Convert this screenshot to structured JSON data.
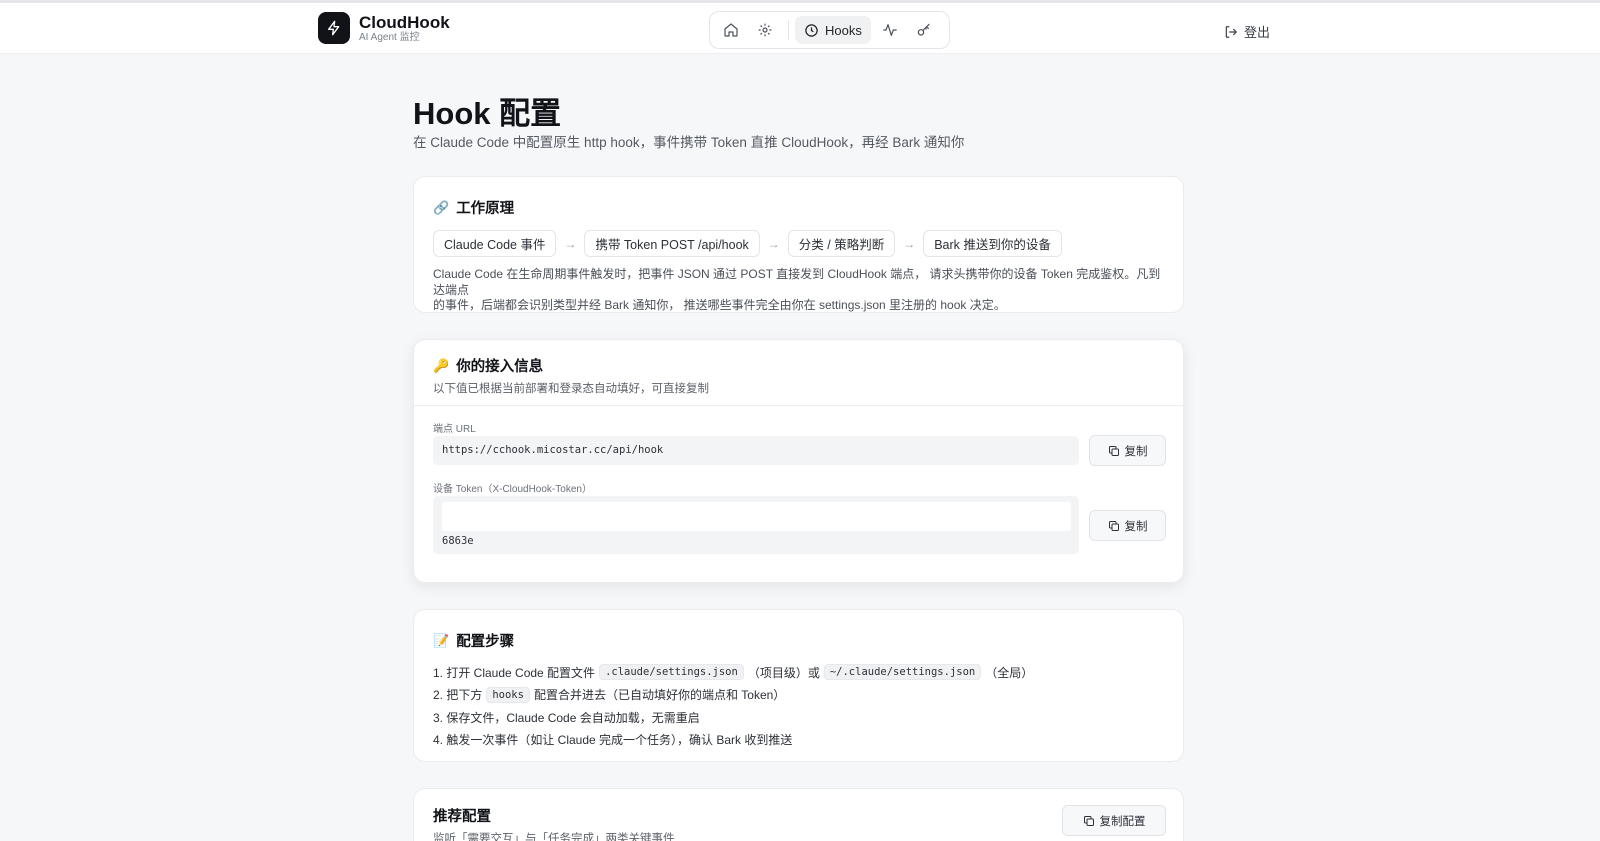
{
  "app": {
    "name": "CloudHook",
    "subtitle": "AI Agent 监控"
  },
  "nav": {
    "items": [
      {
        "icon": "home-icon"
      },
      {
        "icon": "gear-icon"
      },
      {
        "icon": "clock-icon",
        "label": "Hooks",
        "active": true
      },
      {
        "icon": "activity-icon"
      },
      {
        "icon": "key-icon"
      }
    ],
    "logout_label": "登出"
  },
  "page": {
    "title": "Hook 配置",
    "subtitle": "在 Claude Code 中配置原生 http hook，事件携带 Token 直推 CloudHook，再经 Bark 通知你"
  },
  "how_it_works": {
    "emoji": "🔗",
    "title": "工作原理",
    "flow": [
      "Claude Code 事件",
      "携带 Token POST /api/hook",
      "分类 / 策略判断",
      "Bark 推送到你的设备"
    ],
    "arrow": "→",
    "description_line1": "Claude Code 在生命周期事件触发时，把事件 JSON 通过 POST 直接发到 CloudHook 端点， 请求头携带你的设备 Token 完成鉴权。凡到达端点",
    "description_line2": "的事件，后端都会识别类型并经 Bark 通知你， 推送哪些事件完全由你在 settings.json 里注册的 hook 决定。"
  },
  "access_info": {
    "emoji": "🔑",
    "title": "你的接入信息",
    "description": "以下值已根据当前部署和登录态自动填好，可直接复制",
    "endpoint_label": "端点 URL",
    "endpoint_value": "https://cchook.micostar.cc/api/hook",
    "token_label": "设备 Token（X-CloudHook-Token）",
    "token_value_tail": "6863e",
    "copy_label": "复制"
  },
  "steps": {
    "emoji": "📝",
    "title": "配置步骤",
    "step1_a": "1. 打开 Claude Code 配置文件",
    "step1_code1": ".claude/settings.json",
    "step1_b": "（项目级）或",
    "step1_code2": "~/.claude/settings.json",
    "step1_c": "（全局）",
    "step2_a": "2. 把下方",
    "step2_code": "hooks",
    "step2_b": "配置合并进去（已自动填好你的端点和 Token）",
    "step3": "3. 保存文件，Claude Code 会自动加载，无需重启",
    "step4": "4. 触发一次事件（如让 Claude 完成一个任务），确认 Bark 收到推送"
  },
  "recommended": {
    "title": "推荐配置",
    "description": "监听「需要交互」与「任务完成」两类关键事件",
    "copy_label": "复制配置"
  }
}
